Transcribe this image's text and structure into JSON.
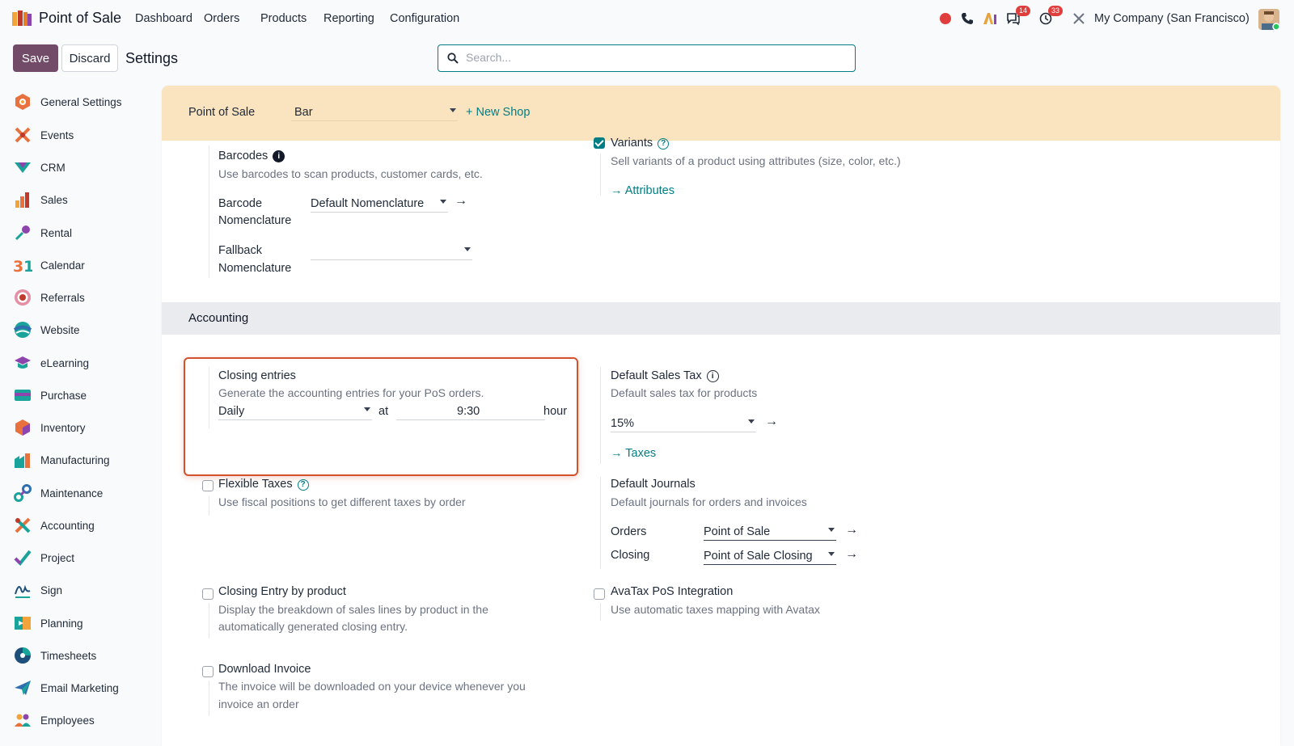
{
  "app": {
    "title": "Point of Sale"
  },
  "nav": {
    "items": [
      "Dashboard",
      "Orders",
      "Products",
      "Reporting",
      "Configuration"
    ]
  },
  "systray": {
    "messages_badge": "14",
    "activities_badge": "33",
    "company": "My Company (San Francisco)"
  },
  "control": {
    "save_label": "Save",
    "discard_label": "Discard",
    "breadcrumb": "Settings",
    "search_placeholder": "Search..."
  },
  "sidebar": {
    "items": [
      {
        "label": "General Settings",
        "icon": "general-settings-icon"
      },
      {
        "label": "Events",
        "icon": "events-icon"
      },
      {
        "label": "CRM",
        "icon": "crm-icon"
      },
      {
        "label": "Sales",
        "icon": "sales-icon"
      },
      {
        "label": "Rental",
        "icon": "rental-icon"
      },
      {
        "label": "Calendar",
        "icon": "calendar-icon"
      },
      {
        "label": "Referrals",
        "icon": "referrals-icon"
      },
      {
        "label": "Website",
        "icon": "website-icon"
      },
      {
        "label": "eLearning",
        "icon": "elearning-icon"
      },
      {
        "label": "Purchase",
        "icon": "purchase-icon"
      },
      {
        "label": "Inventory",
        "icon": "inventory-icon"
      },
      {
        "label": "Manufacturing",
        "icon": "manufacturing-icon"
      },
      {
        "label": "Maintenance",
        "icon": "maintenance-icon"
      },
      {
        "label": "Accounting",
        "icon": "accounting-icon"
      },
      {
        "label": "Project",
        "icon": "project-icon"
      },
      {
        "label": "Sign",
        "icon": "sign-icon"
      },
      {
        "label": "Planning",
        "icon": "planning-icon"
      },
      {
        "label": "Timesheets",
        "icon": "timesheets-icon"
      },
      {
        "label": "Email Marketing",
        "icon": "email-marketing-icon"
      },
      {
        "label": "Employees",
        "icon": "employees-icon"
      }
    ]
  },
  "shop_bar": {
    "label": "Point of Sale",
    "selected_shop": "Bar",
    "new_shop": "+ New Shop"
  },
  "barcodes": {
    "title": "Barcodes",
    "description": "Use barcodes to scan products, customer cards, etc.",
    "nomenclature_label_1": "Barcode",
    "nomenclature_label_2": "Nomenclature",
    "nomenclature_value": "Default Nomenclature",
    "fallback_label_1": "Fallback",
    "fallback_label_2": "Nomenclature",
    "fallback_value": ""
  },
  "variants": {
    "title": "Variants",
    "description": "Sell variants of a product using attributes (size, color, etc.)",
    "link": "Attributes",
    "checked": true
  },
  "accounting": {
    "section_title": "Accounting",
    "closing_entries": {
      "title": "Closing entries",
      "description": "Generate the accounting entries for your PoS orders.",
      "frequency": "Daily",
      "at_label": "at",
      "time": "9:30",
      "hour_label": "hour"
    },
    "default_sales_tax": {
      "title": "Default Sales Tax",
      "description": "Default sales tax for products",
      "value": "15%",
      "link": "Taxes"
    },
    "flexible_taxes": {
      "title": "Flexible Taxes",
      "description": "Use fiscal positions to get different taxes by order",
      "checked": false
    },
    "default_journals": {
      "title": "Default Journals",
      "description": "Default journals for orders and invoices",
      "orders_label": "Orders",
      "orders_value": "Point of Sale",
      "closing_label": "Closing",
      "closing_value": "Point of Sale Closing"
    },
    "closing_by_product": {
      "title": "Closing Entry by product",
      "description_1": "Display the breakdown of sales lines by product in the",
      "description_2": "automatically generated closing entry.",
      "checked": false
    },
    "avatax": {
      "title": "AvaTax PoS Integration",
      "description": "Use automatic taxes mapping with Avatax",
      "checked": false
    },
    "download_invoice": {
      "title": "Download Invoice",
      "description_1": "The invoice will be downloaded on your device whenever you",
      "description_2": "invoice an order",
      "checked": false
    }
  },
  "colors": {
    "brand": "#714b67",
    "accent": "#017e84",
    "highlight": "#d4512e",
    "shop_band": "#fae4c0"
  }
}
